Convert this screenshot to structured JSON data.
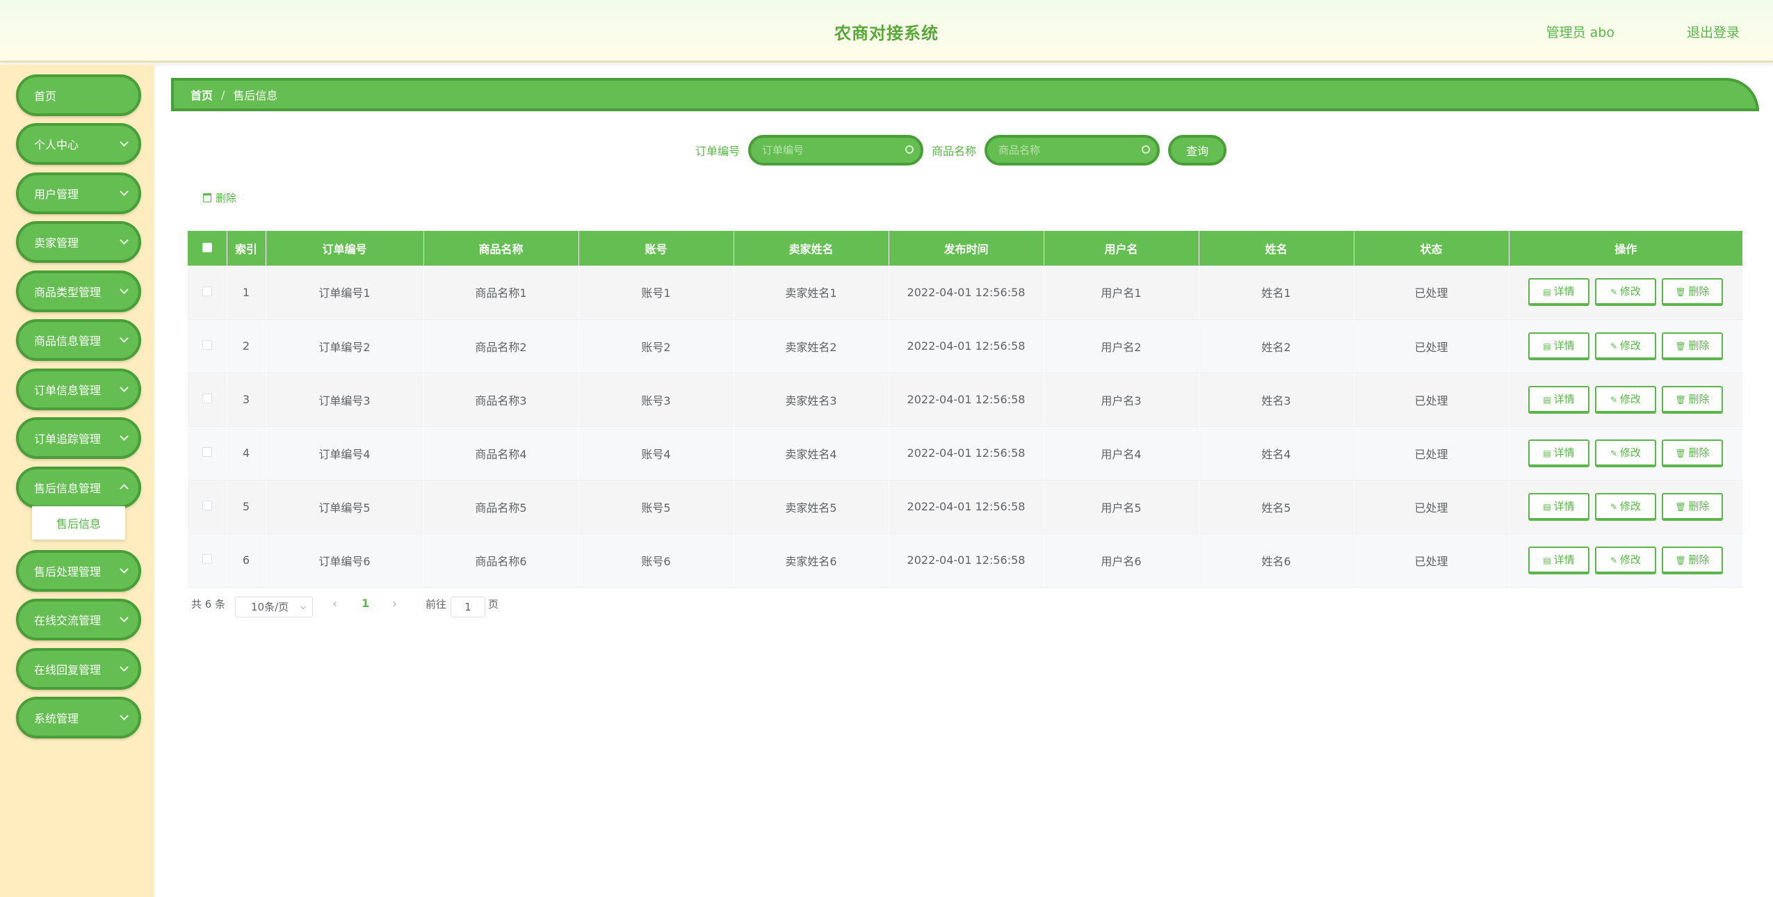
{
  "header": {
    "title": "农商对接系统",
    "user": "管理员 abo",
    "logout": "退出登录"
  },
  "sidebar": {
    "items": [
      {
        "label": "首页"
      },
      {
        "label": "个人中心"
      },
      {
        "label": "用户管理"
      },
      {
        "label": "卖家管理"
      },
      {
        "label": "商品类型管理"
      },
      {
        "label": "商品信息管理"
      },
      {
        "label": "订单信息管理"
      },
      {
        "label": "订单追踪管理"
      },
      {
        "label": "售后信息管理"
      },
      {
        "label": "售后处理管理"
      },
      {
        "label": "在线交流管理"
      },
      {
        "label": "在线回复管理"
      },
      {
        "label": "系统管理"
      }
    ],
    "submenu": "售后信息"
  },
  "breadcrumb": {
    "home": "首页",
    "sep": "/",
    "current": "售后信息"
  },
  "search": {
    "order_label": "订单编号",
    "order_placeholder": "订单编号",
    "product_label": "商品名称",
    "product_placeholder": "商品名称",
    "query_button": "查询"
  },
  "toolbar": {
    "delete_label": "删除"
  },
  "table": {
    "headers": [
      "索引",
      "订单编号",
      "商品名称",
      "账号",
      "卖家姓名",
      "发布时间",
      "用户名",
      "姓名",
      "状态",
      "操作"
    ],
    "rows": [
      {
        "index": "1",
        "order": "订单编号1",
        "product": "商品名称1",
        "account": "账号1",
        "seller": "卖家姓名1",
        "time": "2022-04-01 12:56:58",
        "username": "用户名1",
        "name": "姓名1",
        "status": "已处理"
      },
      {
        "index": "2",
        "order": "订单编号2",
        "product": "商品名称2",
        "account": "账号2",
        "seller": "卖家姓名2",
        "time": "2022-04-01 12:56:58",
        "username": "用户名2",
        "name": "姓名2",
        "status": "已处理"
      },
      {
        "index": "3",
        "order": "订单编号3",
        "product": "商品名称3",
        "account": "账号3",
        "seller": "卖家姓名3",
        "time": "2022-04-01 12:56:58",
        "username": "用户名3",
        "name": "姓名3",
        "status": "已处理"
      },
      {
        "index": "4",
        "order": "订单编号4",
        "product": "商品名称4",
        "account": "账号4",
        "seller": "卖家姓名4",
        "time": "2022-04-01 12:56:58",
        "username": "用户名4",
        "name": "姓名4",
        "status": "已处理"
      },
      {
        "index": "5",
        "order": "订单编号5",
        "product": "商品名称5",
        "account": "账号5",
        "seller": "卖家姓名5",
        "time": "2022-04-01 12:56:58",
        "username": "用户名5",
        "name": "姓名5",
        "status": "已处理"
      },
      {
        "index": "6",
        "order": "订单编号6",
        "product": "商品名称6",
        "account": "账号6",
        "seller": "卖家姓名6",
        "time": "2022-04-01 12:56:58",
        "username": "用户名6",
        "name": "姓名6",
        "status": "已处理"
      }
    ],
    "actions": {
      "detail": "详情",
      "edit": "修改",
      "delete": "删除"
    }
  },
  "pagination": {
    "total": "共 6 条",
    "page_size": "10条/页",
    "current_page": "1",
    "goto": "前往",
    "goto_value": "1",
    "page_suffix": "页"
  },
  "colors": {
    "primary": "#65be52",
    "primary_dark": "#4a9e39",
    "sidebar_bg": "#ffecbf",
    "accent_text": "#5bb54a"
  }
}
